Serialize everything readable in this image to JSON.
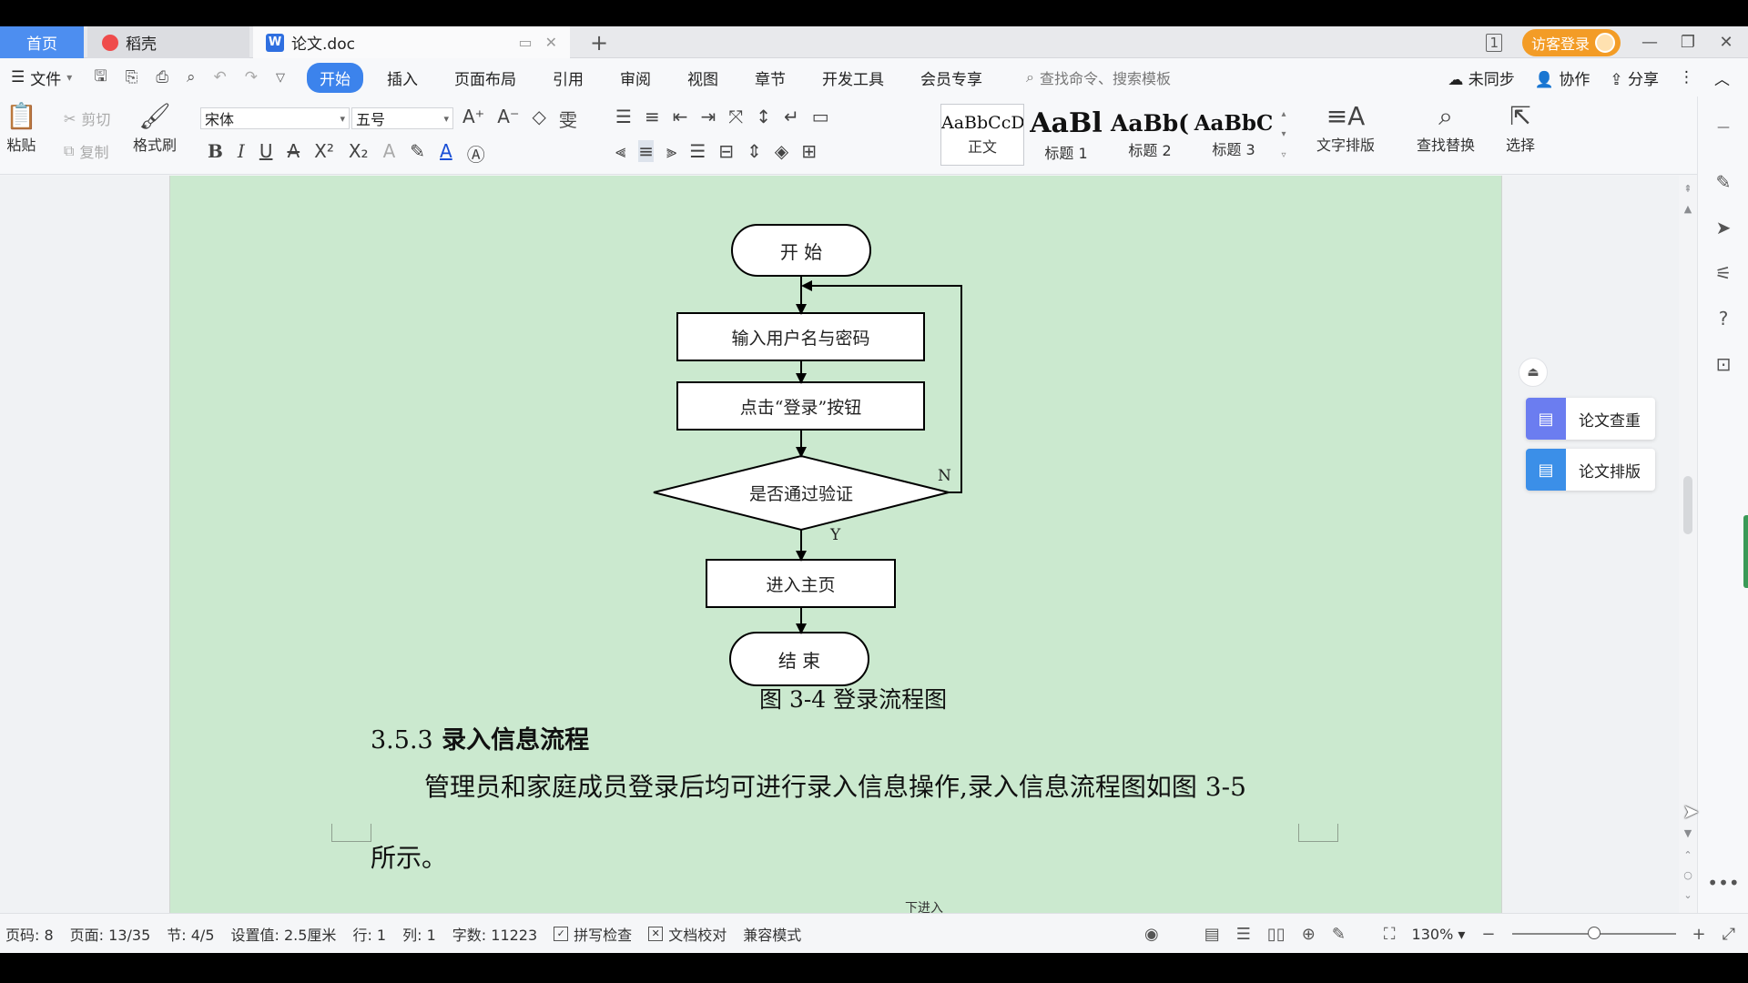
{
  "tabs": {
    "home": "首页",
    "daoke": "稻壳",
    "doc": "论文.doc",
    "new_tab": "+"
  },
  "window": {
    "login": "访客登录",
    "layout_badge": "1"
  },
  "menu": {
    "file": "文件",
    "tabs": [
      "开始",
      "插入",
      "页面布局",
      "引用",
      "审阅",
      "视图",
      "章节",
      "开发工具",
      "会员专享"
    ],
    "active_tab": "开始",
    "search_placeholder": "查找命令、搜索模板",
    "sync": "未同步",
    "collab": "协作",
    "share": "分享"
  },
  "ribbon": {
    "paste": "粘贴",
    "cut": "剪切",
    "copy": "复制",
    "format_painter": "格式刷",
    "font_name": "宋体",
    "font_size": "五号",
    "styles": [
      {
        "preview": "AaBbCcDd",
        "name": "正文"
      },
      {
        "preview": "AaBl",
        "name": "标题 1"
      },
      {
        "preview": "AaBb(",
        "name": "标题 2"
      },
      {
        "preview": "AaBbC",
        "name": "标题 3"
      }
    ],
    "text_layout": "文字排版",
    "find_replace": "查找替换",
    "select": "选择"
  },
  "flowchart": {
    "start": "开 始",
    "input": "输入用户名与密码",
    "click_login": "点击“登录”按钮",
    "verify": "是否通过验证",
    "no_label": "N",
    "yes_label": "Y",
    "home_page": "进入主页",
    "end": "结 束"
  },
  "document": {
    "figure_caption": "图 3-4 登录流程图",
    "section_number": "3.5.3",
    "section_title": "录入信息流程",
    "paragraph_line1": "管理员和家庭成员登录后均可进行录入信息操作,录入信息流程图如图 3-5",
    "paragraph_line2": "所示。",
    "next_page_partial": "下进入"
  },
  "side_panel": {
    "check_paper": "论文查重",
    "format_paper": "论文排版"
  },
  "status": {
    "page_code": "页码: 8",
    "page": "页面: 13/35",
    "section": "节: 4/5",
    "setting": "设置值: 2.5厘米",
    "row": "行: 1",
    "col": "列: 1",
    "word_count": "字数: 11223",
    "spell_check": "拼写检查",
    "doc_proof": "文档校对",
    "compat_mode": "兼容模式",
    "zoom": "130%",
    "zoom_fraction": 0.5
  },
  "colors": {
    "page_background": "#cbe9cf",
    "active_tab": "#3c83ec",
    "home_tab": "#4d8ef0",
    "login_button": "#f39c26"
  }
}
